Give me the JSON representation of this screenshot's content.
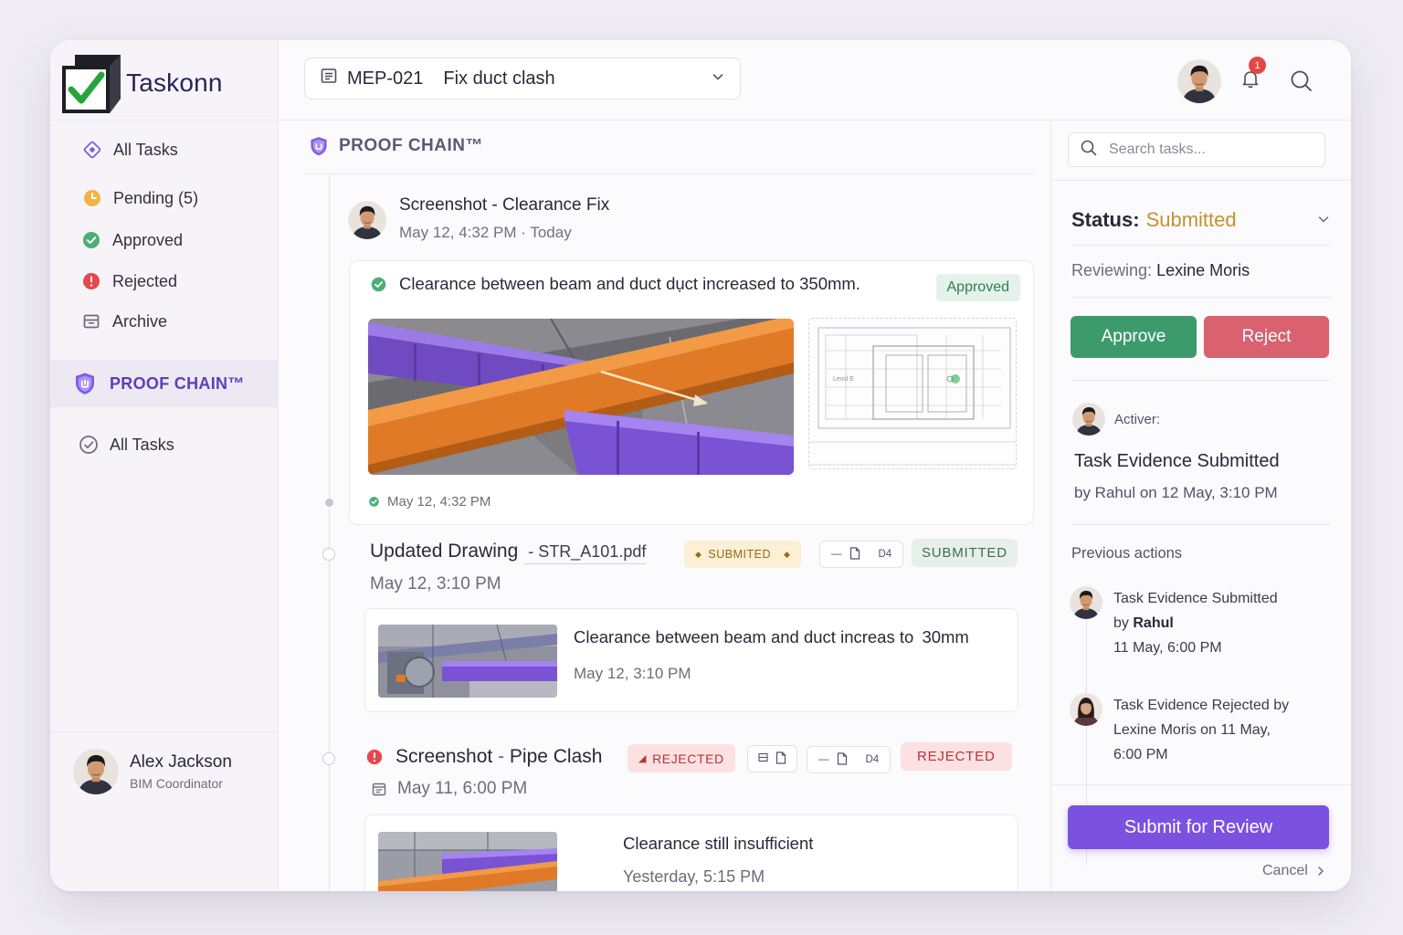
{
  "brand": {
    "name": "Taskonn"
  },
  "sidebar": {
    "items": [
      {
        "label": "All Tasks",
        "icon": "diamond-icon"
      },
      {
        "label": "Pending (5)",
        "icon": "clock-icon"
      },
      {
        "label": "Approved",
        "icon": "check-circle-icon"
      },
      {
        "label": "Rejected",
        "icon": "alert-circle-icon"
      },
      {
        "label": "Archive",
        "icon": "archive-icon"
      }
    ],
    "proof_chain": "PROOF CHAIN™",
    "sub_items": [
      {
        "label": "All Tasks",
        "icon": "check-circle-outline-icon"
      }
    ],
    "user": {
      "name": "Alex Jackson",
      "role": "BIM Coordinator"
    }
  },
  "header": {
    "task_code": "MEP-021",
    "task_title": "Fix duct clash",
    "notification_count": "1"
  },
  "main": {
    "title": "PROOF CHAIN™",
    "entries": [
      {
        "title": "Screenshot - Clearance Fix",
        "date": "May 12, 4:32 PM",
        "relative": "· Today",
        "note": "Clearance between beam and duct dụct increased to 350mm.",
        "badge": "Approved",
        "plan_label": "Levsl E",
        "footer_date": "May 12, 4:32 PM"
      },
      {
        "title": "Updated Drawing",
        "dash": " - ",
        "file": "STR_A101.pdf",
        "chip_yellow": "SUBMITED",
        "version": "D4",
        "chip_green": "SUBMITTED",
        "date": "May 12, 3:10 PM",
        "card_text": "Clearance between beam and duct increas to",
        "card_value": "30mm",
        "card_date": "May 12, 3:10 PM"
      },
      {
        "title": "Screenshot",
        "dash": " - ",
        "title_b": "Pipe Clash",
        "chip_red": "REJECTED",
        "version": "D4",
        "chip_red2": "REJECTED",
        "date": "May 11, 6:00 PM",
        "card_text": "Clearance still insufficient",
        "card_date": "Yesterday, 5:15 PM"
      }
    ]
  },
  "panel": {
    "search_placeholder": "Search tasks...",
    "status_label": "Status:",
    "status_value": "Submitted",
    "reviewing_label": "Reviewing:",
    "reviewing_name": "Lexine Moris",
    "approve": "Approve",
    "reject": "Reject",
    "activer_label": "Activer:",
    "activity_title": "Task Evidence Submitted",
    "activity_sub": "by Rahul on 12 May, 3:10 PM",
    "previous_heading": "Previous actions",
    "previous": [
      {
        "line1": "Task Evidence Submitted",
        "by": "by",
        "name": "Rahul",
        "line3": "11 May, 6:00 PM"
      },
      {
        "line1": "Task Evidence Rejected by",
        "line2": "Lexine Moris on 11 May,",
        "line3": "6:00 PM"
      }
    ],
    "submit": "Submit for Review",
    "cancel": "Cancel"
  },
  "colors": {
    "accent": "#7b52e0",
    "approve": "#3c9a6b",
    "reject": "#d96170",
    "status": "#c4922a"
  }
}
